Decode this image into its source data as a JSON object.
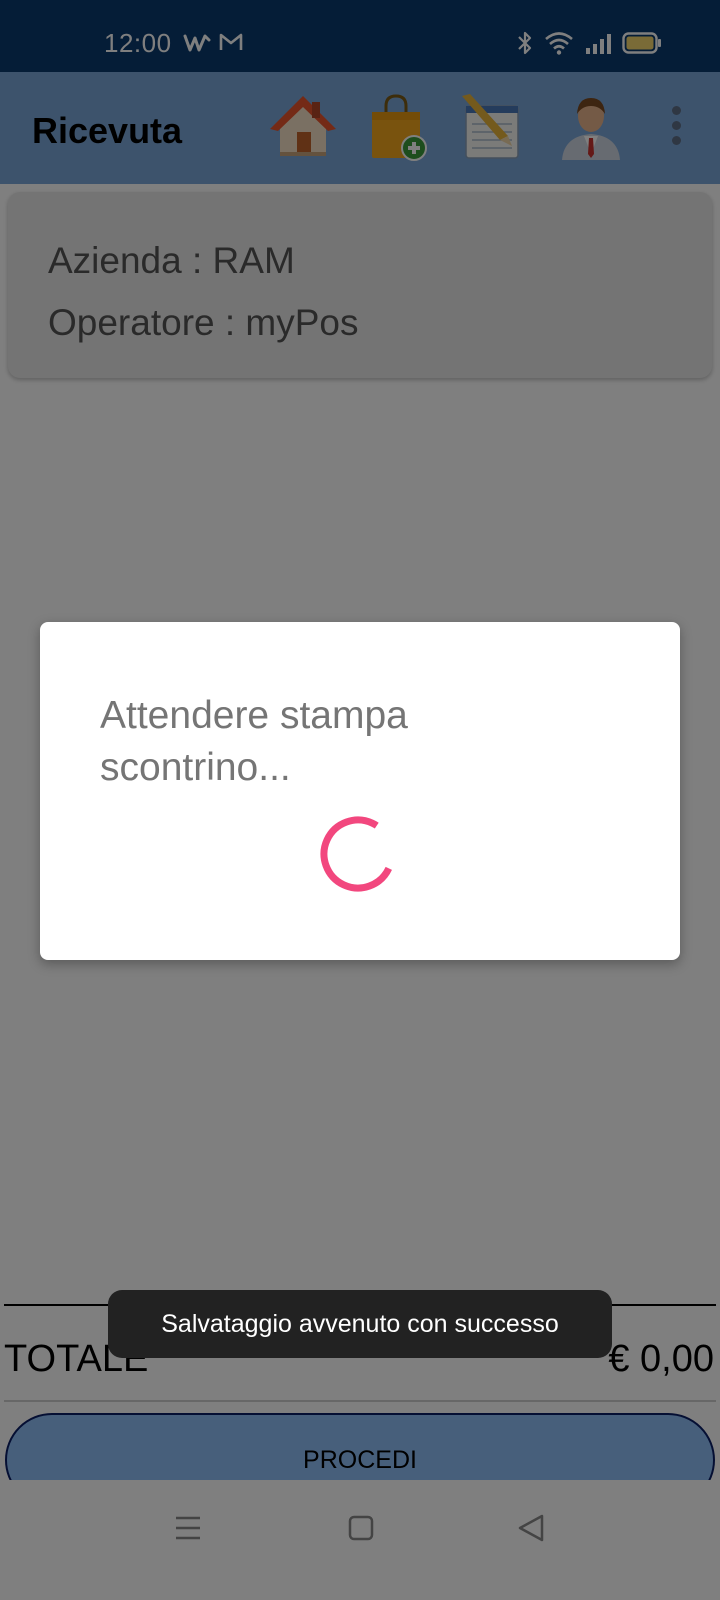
{
  "status_bar": {
    "time": "12:00",
    "app_icons": [
      "w-app-icon",
      "gmail-icon"
    ],
    "right_icons": [
      "bluetooth-icon",
      "wifi-icon",
      "signal-icon",
      "battery-icon"
    ],
    "battery_color": "#f5d76e"
  },
  "app_bar": {
    "title": "Ricevuta",
    "actions": [
      "home-icon",
      "shopping-bag-add-icon",
      "notepad-icon",
      "user-icon",
      "more-vert-icon"
    ]
  },
  "info": {
    "azienda": "Azienda : RAM",
    "operatore": "Operatore : myPos"
  },
  "totals": {
    "label": "TOTALE",
    "value": "€ 0,00"
  },
  "procedi_label": "PROCEDI",
  "dialog": {
    "message": "Attendere stampa scontrino...",
    "spinner_color": "#f2477e"
  },
  "toast": {
    "message": "Salvataggio avvenuto con successo"
  },
  "colors": {
    "status_bar": "#0b3a6e",
    "app_bar": "#7ba6d8",
    "button": "#8fbef6",
    "button_border": "#0b1e66"
  },
  "nav": [
    "menu-icon",
    "home-square-icon",
    "back-triangle-icon"
  ]
}
